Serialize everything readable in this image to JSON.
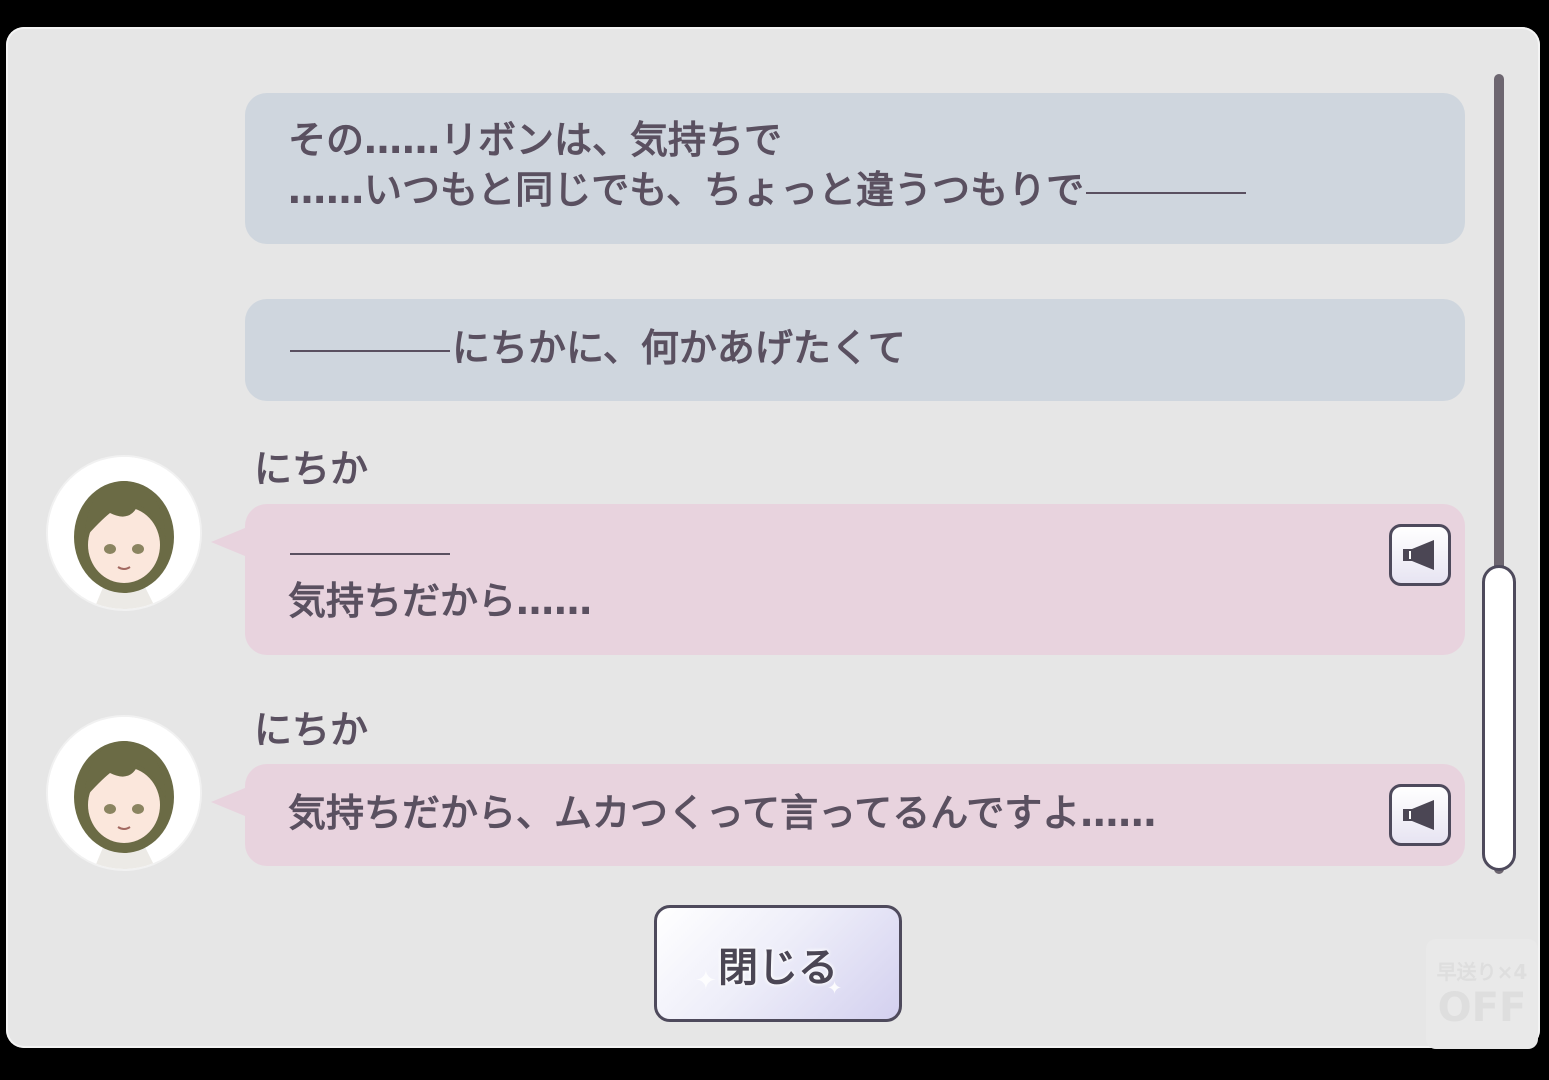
{
  "log": {
    "entries": [
      {
        "type": "narration",
        "lines": [
          "その……リボンは、気持ちで",
          "……いつもと同じでも、ちょっと違うつもりで"
        ]
      },
      {
        "type": "narration",
        "lines": [
          "にちかに、何かあげたくて"
        ]
      },
      {
        "type": "dialogue",
        "speaker": "にちか",
        "lines": [
          "",
          "気持ちだから……"
        ],
        "voice_icon": "speaker-icon"
      },
      {
        "type": "dialogue",
        "speaker": "にちか",
        "lines": [
          "気持ちだから、ムカつくって言ってるんですよ……"
        ],
        "voice_icon": "speaker-icon"
      }
    ]
  },
  "buttons": {
    "close_label": "閉じる"
  },
  "fast_forward": {
    "label": "早送り×4",
    "state": "OFF"
  },
  "scroll": {
    "position": 1.0
  },
  "colors": {
    "narration_bubble": "#cfd6de",
    "dialogue_bubble": "#e8d3de",
    "text": "#5a5060",
    "panel": "#e6e6e6"
  }
}
